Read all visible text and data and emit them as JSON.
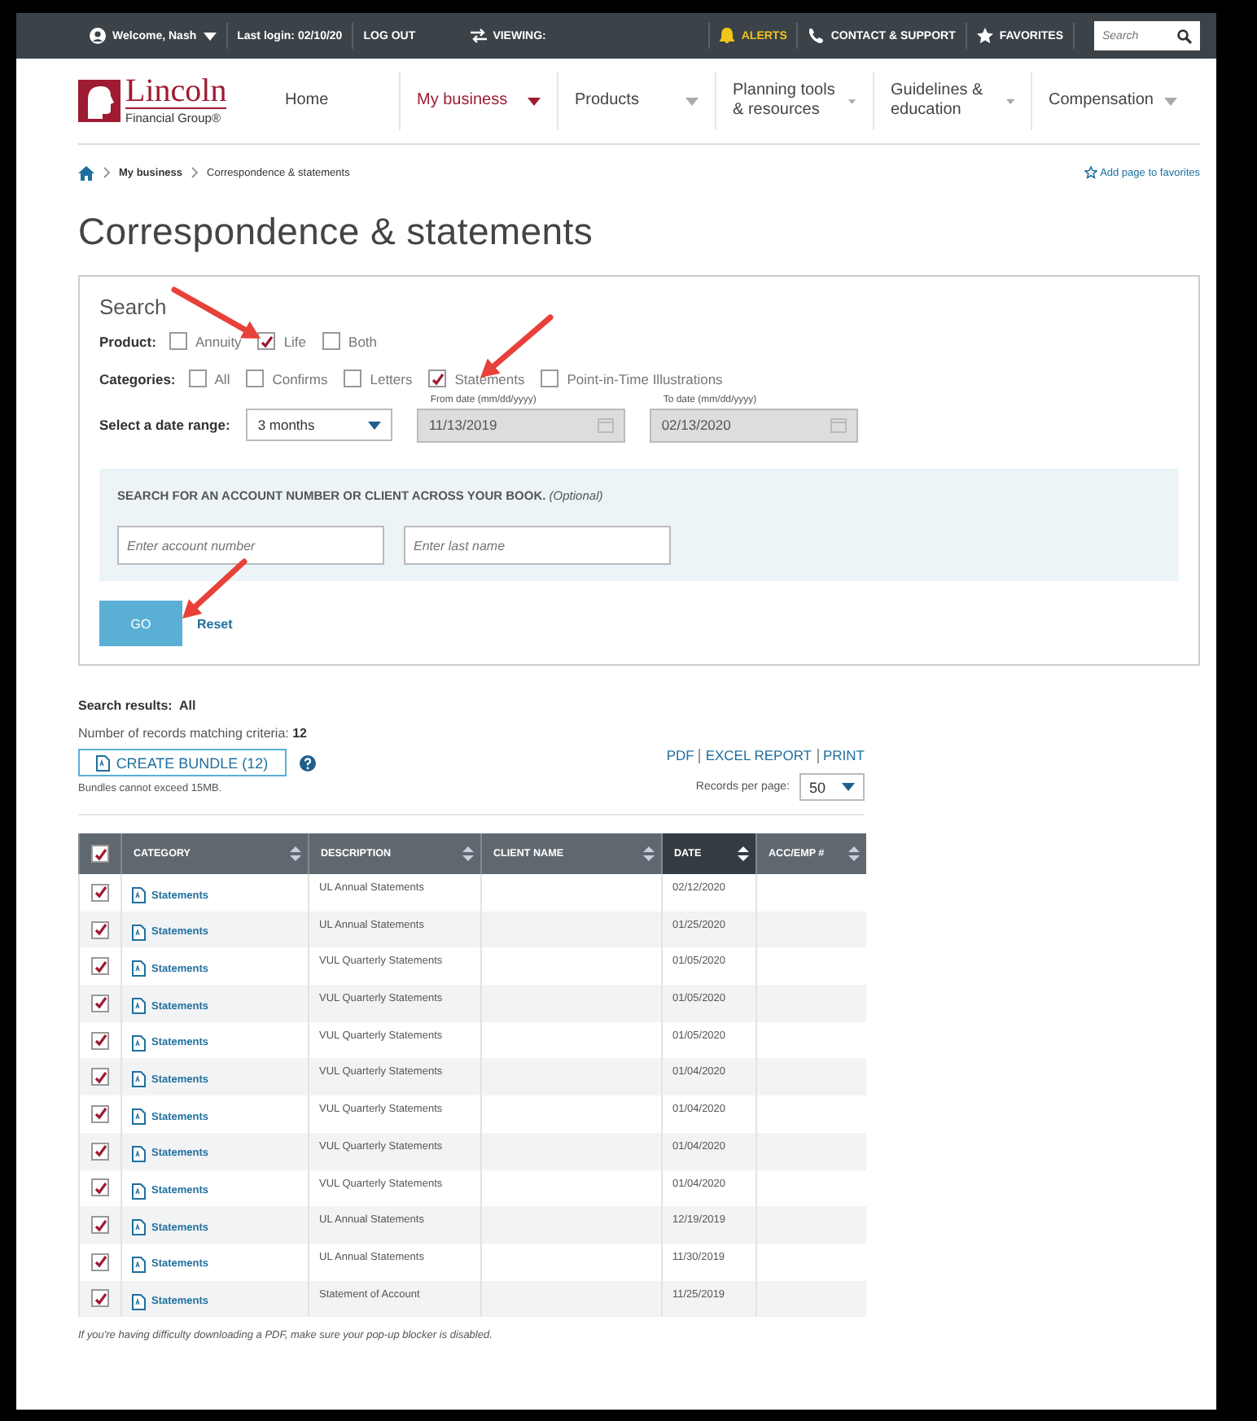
{
  "top_bar": {
    "user": "Welcome, Nash",
    "last_login": "Last login: 02/10/20",
    "logout": "LOG OUT",
    "viewing": "VIEWING:",
    "alerts": "ALERTS",
    "contact": "CONTACT & SUPPORT",
    "favorites": "FAVORITES",
    "search": {
      "placeholder": "Search"
    }
  },
  "logo": {
    "name": "Lincoln",
    "sub": "Financial Group®"
  },
  "nav": [
    {
      "label": "Home",
      "selected": false,
      "dropdown": false
    },
    {
      "label": "My business",
      "selected": true,
      "dropdown": true
    },
    {
      "label": "Products",
      "selected": false,
      "dropdown": true
    },
    {
      "label": "Planning tools & resources",
      "selected": false,
      "dropdown": true
    },
    {
      "label": "Guidelines & education",
      "selected": false,
      "dropdown": true
    },
    {
      "label": "Compensation",
      "selected": false,
      "dropdown": true
    }
  ],
  "breadcrumb": [
    "My business",
    "Correspondence & statements"
  ],
  "add_favorites": "Add page to favorites",
  "title": "Correspondence & statements",
  "search": {
    "heading": "Search",
    "product_label": "Product:",
    "products": [
      {
        "label": "Annuity",
        "checked": false
      },
      {
        "label": "Life",
        "checked": true
      },
      {
        "label": "Both",
        "checked": false
      }
    ],
    "categories_label": "Categories:",
    "categories": [
      {
        "label": "All",
        "checked": false
      },
      {
        "label": "Confirms",
        "checked": false
      },
      {
        "label": "Letters",
        "checked": false
      },
      {
        "label": "Statements",
        "checked": true
      },
      {
        "label": "Point-in-Time Illustrations",
        "checked": false
      }
    ],
    "date_range_label": "Select a date range:",
    "date_range": "3 months",
    "from_date": {
      "label": "From date (mm/dd/yyyy)",
      "value": "11/13/2019",
      "disabled": true
    },
    "to_date": {
      "label": "To date (mm/dd/yyyy)",
      "value": "02/13/2020",
      "disabled": true
    },
    "account_heading": "SEARCH FOR AN ACCOUNT NUMBER OR CLIENT ACROSS YOUR BOOK.",
    "optional": "(Optional)",
    "account": {
      "placeholder": "Enter account number"
    },
    "last_name": {
      "placeholder": "Enter last name"
    },
    "go": "GO",
    "reset": "Reset"
  },
  "results": {
    "label": "Search results:",
    "value": "All",
    "count_label": "Number of records matching criteria:",
    "count": "12",
    "bundle": "CREATE BUNDLE (12)",
    "bundle_note": "Bundles cannot exceed 15MB.",
    "links": [
      "PDF",
      "EXCEL REPORT",
      "PRINT"
    ],
    "per_page_label": "Records per page:",
    "per_page": "50"
  },
  "table": {
    "select_all_checked": true,
    "columns": [
      {
        "label": "CATEGORY",
        "sorted": false
      },
      {
        "label": "DESCRIPTION",
        "sorted": false
      },
      {
        "label": "CLIENT NAME",
        "sorted": false
      },
      {
        "label": "DATE",
        "sorted": true
      },
      {
        "label": "ACC/EMP #",
        "sorted": false
      }
    ],
    "rows": [
      {
        "checked": true,
        "category": "Statements",
        "description": "UL Annual Statements",
        "date": "02/12/2020"
      },
      {
        "checked": true,
        "category": "Statements",
        "description": "UL Annual Statements",
        "date": "01/25/2020"
      },
      {
        "checked": true,
        "category": "Statements",
        "description": "VUL Quarterly Statements",
        "date": "01/05/2020"
      },
      {
        "checked": true,
        "category": "Statements",
        "description": "VUL Quarterly Statements",
        "date": "01/05/2020"
      },
      {
        "checked": true,
        "category": "Statements",
        "description": "VUL Quarterly Statements",
        "date": "01/05/2020"
      },
      {
        "checked": true,
        "category": "Statements",
        "description": "VUL Quarterly Statements",
        "date": "01/04/2020"
      },
      {
        "checked": true,
        "category": "Statements",
        "description": "VUL Quarterly Statements",
        "date": "01/04/2020"
      },
      {
        "checked": true,
        "category": "Statements",
        "description": "VUL Quarterly Statements",
        "date": "01/04/2020"
      },
      {
        "checked": true,
        "category": "Statements",
        "description": "VUL Quarterly Statements",
        "date": "01/04/2020"
      },
      {
        "checked": true,
        "category": "Statements",
        "description": "UL Annual Statements",
        "date": "12/19/2019"
      },
      {
        "checked": true,
        "category": "Statements",
        "description": "UL Annual Statements",
        "date": "11/30/2019"
      },
      {
        "checked": true,
        "category": "Statements",
        "description": "Statement of Account",
        "date": "11/25/2019"
      }
    ]
  },
  "footnote": "If you're having difficulty downloading a PDF, make sure your pop-up blocker is disabled."
}
